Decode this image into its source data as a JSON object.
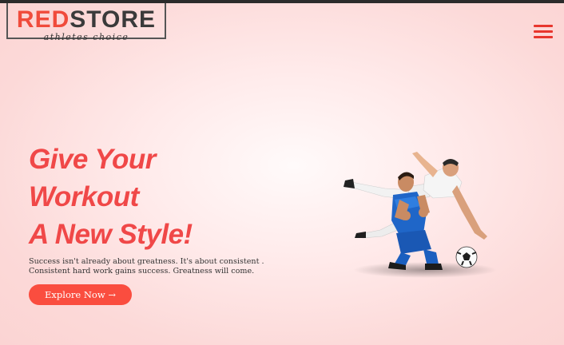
{
  "brand": {
    "logo_part_red": "RED",
    "logo_part_dark": "STORE",
    "tagline": "athletes choice",
    "accent": "#f04b3b"
  },
  "header": {
    "menu_icon": "hamburger-menu-icon"
  },
  "hero": {
    "headline_lines": [
      "Give Your",
      "Workout",
      "A New Style!"
    ],
    "description_lines": [
      "Success isn't already about greatness. It's about consistent .",
      "Consistent hard work gains success. Greatness will come."
    ],
    "cta_label": "Explore Now →",
    "cta_color": "#fa4d3f",
    "image": "football-players-tackle-image"
  }
}
